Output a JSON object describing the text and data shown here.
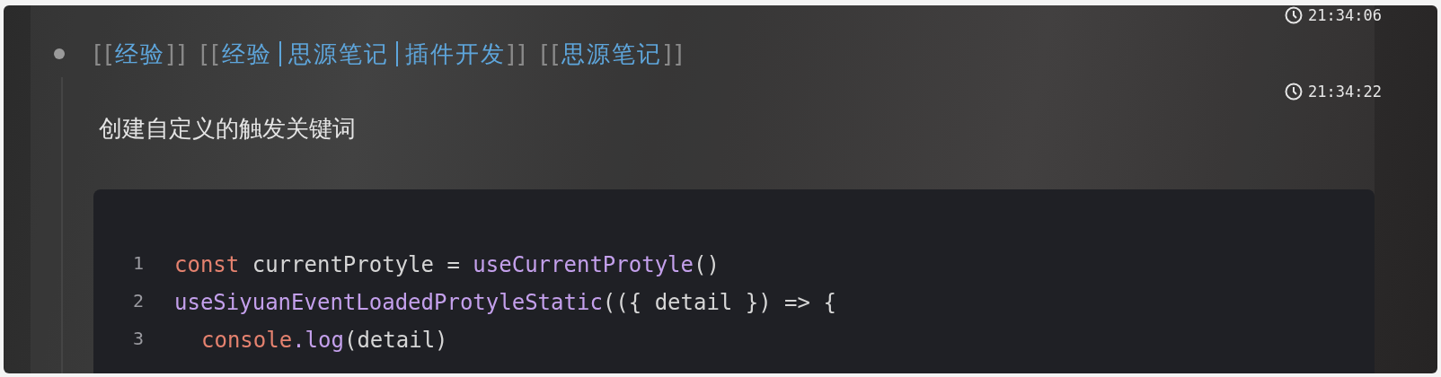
{
  "blocks": [
    {
      "kind": "tags",
      "time": "21:34:06",
      "tags": [
        {
          "open": "[[",
          "parts": [
            "经验"
          ],
          "close": "]]"
        },
        {
          "open": "[[",
          "parts": [
            "经验",
            "思源笔记",
            "插件开发"
          ],
          "close": "]]"
        },
        {
          "open": "[[",
          "parts": [
            "思源笔记"
          ],
          "close": "]]"
        }
      ]
    },
    {
      "kind": "paragraph",
      "time": "21:34:22",
      "text": "创建自定义的触发关键词"
    }
  ],
  "code": {
    "lines": [
      {
        "number": "1",
        "tokens": [
          {
            "kind": "keyword",
            "text": "const"
          },
          {
            "kind": "plain",
            "text": " currentProtyle = "
          },
          {
            "kind": "function",
            "text": "useCurrentProtyle"
          },
          {
            "kind": "plain",
            "text": "()"
          }
        ]
      },
      {
        "number": "2",
        "tokens": [
          {
            "kind": "function",
            "text": "useSiyuanEventLoadedProtyleStatic"
          },
          {
            "kind": "plain",
            "text": "(({ detail }) => {"
          }
        ]
      },
      {
        "number": "3",
        "indent": true,
        "tokens": [
          {
            "kind": "keyword",
            "text": "console"
          },
          {
            "kind": "function",
            "text": ".log"
          },
          {
            "kind": "plain",
            "text": "(detail)"
          }
        ]
      }
    ]
  }
}
